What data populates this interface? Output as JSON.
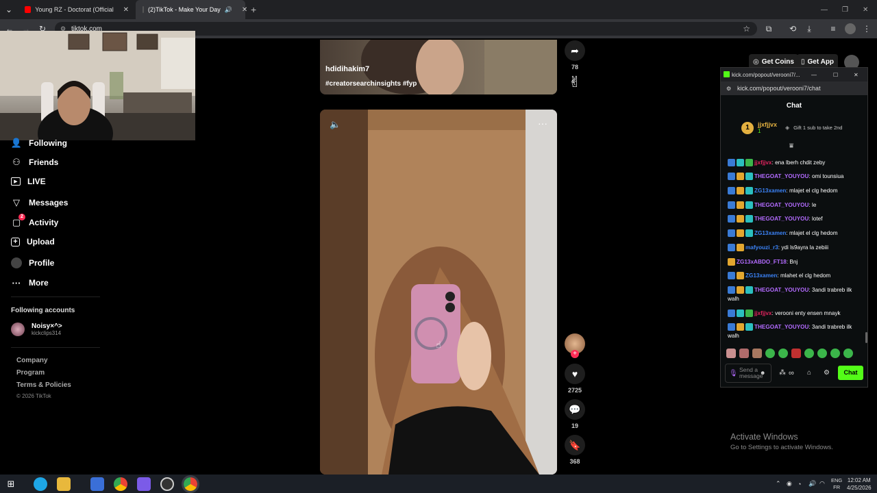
{
  "browser": {
    "tabs": [
      {
        "title": "Young RZ - Doctorat (Official M",
        "fav_color": "#ff0000"
      },
      {
        "title": "(2)TikTok - Make Your Day",
        "fav_color": "#111111"
      }
    ],
    "url": "tiktok.com"
  },
  "sidebar": {
    "items": [
      {
        "label": "Following",
        "icon": "following-icon"
      },
      {
        "label": "Friends",
        "icon": "friends-icon"
      },
      {
        "label": "LIVE",
        "icon": "live-icon"
      },
      {
        "label": "Messages",
        "icon": "messages-icon"
      },
      {
        "label": "Activity",
        "icon": "activity-icon",
        "badge": "2"
      },
      {
        "label": "Upload",
        "icon": "upload-icon"
      },
      {
        "label": "Profile",
        "icon": "profile-icon"
      },
      {
        "label": "More",
        "icon": "more-icon"
      }
    ],
    "following_heading": "Following accounts",
    "account": {
      "name": "Noisy×^>",
      "handle": "kickclips314"
    },
    "footer": [
      "Company",
      "Program",
      "Terms & Policies",
      "© 2026 TikTok"
    ]
  },
  "video1": {
    "author": "hdidihakim7",
    "tags": "#creatorsearchinsights #fyp"
  },
  "actions1": {
    "share_count": "78"
  },
  "actions2": {
    "likes": "2725",
    "comments": "19",
    "saves": "368"
  },
  "topbuttons": {
    "coins": "Get Coins",
    "app": "Get App"
  },
  "kick": {
    "window_title": "kick.com/popout/verooni7/...",
    "url": "kick.com/popout/verooni7/chat",
    "header": "Chat",
    "gift_user": "jjxfjjvx",
    "gift_count": "1",
    "gift_text": "Gift 1 sub to take 2nd",
    "messages": [
      {
        "user": "jjxfjjvx",
        "color": "#e0245e",
        "text": "ena lberh chdit zeby"
      },
      {
        "user": "THEGOAT_YOUYOU",
        "color": "#b36bff",
        "text": "omi tounsiua"
      },
      {
        "user": "ZG13xamen",
        "color": "#3b82f6",
        "text": "mlajet el clg hedom"
      },
      {
        "user": "THEGOAT_YOUYOU",
        "color": "#b36bff",
        "text": "le"
      },
      {
        "user": "THEGOAT_YOUYOU",
        "color": "#b36bff",
        "text": "lotef"
      },
      {
        "user": "ZG13xamen",
        "color": "#3b82f6",
        "text": "mlajet el clg hedom"
      },
      {
        "user": "mafyouzi_r3",
        "color": "#3b82f6",
        "text": "ydi ls9ayra la zebiii"
      },
      {
        "user": "ZG13xABDO_FT18",
        "color": "#b36bff",
        "text": "Bnj"
      },
      {
        "user": "ZG13xamen",
        "color": "#3b82f6",
        "text": "mlahet el clg hedom"
      },
      {
        "user": "THEGOAT_YOUYOU",
        "color": "#b36bff",
        "text": "3andi trabreb ilk walh"
      },
      {
        "user": "jjxfjjvx",
        "color": "#e0245e",
        "text": "verooni enty ensen mnayk"
      },
      {
        "user": "THEGOAT_YOUYOU",
        "color": "#b36bff",
        "text": "3andi trabreb ilk walh"
      }
    ],
    "input_placeholder": "Send a message",
    "send_label": "Chat"
  },
  "watermark": {
    "line1": "Activate Windows",
    "line2": "Go to Settings to activate Windows."
  },
  "taskbar": {
    "lang1": "ENG",
    "lang2": "FR",
    "time": "12:02 AM",
    "date": "4/25/2026"
  }
}
